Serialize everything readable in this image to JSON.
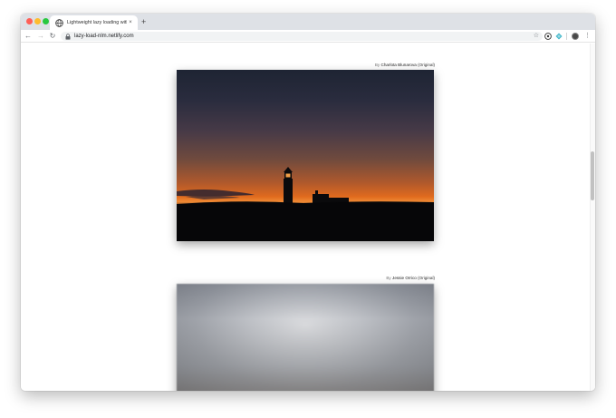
{
  "browser": {
    "tab_title": "Lightweight lazy loading with n",
    "tab_close": "×",
    "new_tab": "+",
    "url": "lazy-load-nlm.netlify.com",
    "nav": {
      "back": "←",
      "forward": "→",
      "reload": "↻"
    },
    "star": "☆",
    "menu": "⋮"
  },
  "images": [
    {
      "credit_prefix": "By",
      "author": "Charlota Blunarova",
      "original_label": "(Original)"
    },
    {
      "credit_prefix": "By",
      "author": "Jessie Orrico",
      "original_label": "(Original)"
    }
  ],
  "colors": {
    "chrome": "#dee1e6",
    "sunset_orange": "#e06a1e",
    "dusk_blue": "#1e2433"
  }
}
